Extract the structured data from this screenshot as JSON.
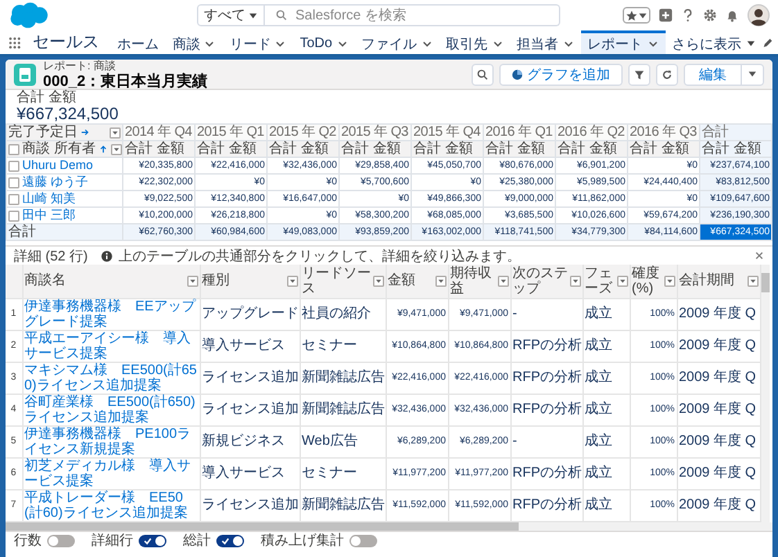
{
  "search": {
    "scope": "すべて",
    "placeholder": "Salesforce を検索"
  },
  "app_name": "セールス",
  "nav_tabs": [
    {
      "label": "ホーム",
      "kind": "plain",
      "selected": false
    },
    {
      "label": "商談",
      "kind": "menu",
      "selected": false
    },
    {
      "label": "リード",
      "kind": "menu",
      "selected": false
    },
    {
      "label": "ToDo",
      "kind": "menu",
      "selected": false
    },
    {
      "label": "ファイル",
      "kind": "menu",
      "selected": false
    },
    {
      "label": "取引先",
      "kind": "menu",
      "selected": false
    },
    {
      "label": "担当者",
      "kind": "menu",
      "selected": false
    },
    {
      "label": "レポート",
      "kind": "menu",
      "selected": true
    },
    {
      "label": "さらに表示",
      "kind": "more",
      "selected": false
    }
  ],
  "report": {
    "type_label": "レポート: 商談",
    "title": "000_2：東日本当月実績",
    "buttons": [
      {
        "kind": "search"
      },
      {
        "kind": "add-chart",
        "label": "グラフを追加"
      },
      {
        "kind": "filter"
      },
      {
        "kind": "refresh"
      },
      {
        "kind": "edit",
        "label": "編集"
      }
    ]
  },
  "summary": {
    "label": "合計 金額",
    "value": "¥667,324,500"
  },
  "matrix": {
    "column_group_label": "完了予定日",
    "row_group_label": "商談 所有者",
    "all_checked": false,
    "columns": [
      {
        "period": "2014 年 Q4",
        "measure": "合計 金額",
        "kind": "period"
      },
      {
        "period": "2015 年 Q1",
        "measure": "合計 金額",
        "kind": "period"
      },
      {
        "period": "2015 年 Q2",
        "measure": "合計 金額",
        "kind": "period"
      },
      {
        "period": "2015 年 Q3",
        "measure": "合計 金額",
        "kind": "period"
      },
      {
        "period": "2015 年 Q4",
        "measure": "合計 金額",
        "kind": "period"
      },
      {
        "period": "2016 年 Q1",
        "measure": "合計 金額",
        "kind": "period"
      },
      {
        "period": "2016 年 Q2",
        "measure": "合計 金額",
        "kind": "period"
      },
      {
        "period": "2016 年 Q3",
        "measure": "合計 金額",
        "kind": "period"
      },
      {
        "period": "合計",
        "measure": "合計 金額",
        "kind": "total"
      }
    ],
    "rows": [
      {
        "owner": "Uhuru Demo",
        "checked": false,
        "values": [
          "¥20,335,800",
          "¥22,416,000",
          "¥32,436,000",
          "¥29,858,400",
          "¥45,050,700",
          "¥80,676,000",
          "¥6,901,200",
          "¥0",
          "¥237,674,100"
        ]
      },
      {
        "owner": "遠藤 ゆう子",
        "checked": false,
        "values": [
          "¥22,302,000",
          "¥0",
          "¥0",
          "¥5,700,600",
          "¥0",
          "¥25,380,000",
          "¥5,989,500",
          "¥24,440,400",
          "¥83,812,500"
        ]
      },
      {
        "owner": "山崎 知美",
        "checked": false,
        "values": [
          "¥9,022,500",
          "¥12,340,800",
          "¥16,647,000",
          "¥0",
          "¥49,866,300",
          "¥9,000,000",
          "¥11,862,000",
          "¥0",
          "¥109,647,600"
        ]
      },
      {
        "owner": "田中 三郎",
        "checked": false,
        "values": [
          "¥10,200,000",
          "¥26,218,800",
          "¥0",
          "¥58,300,200",
          "¥68,085,000",
          "¥3,685,500",
          "¥10,026,600",
          "¥59,674,200",
          "¥236,190,300"
        ]
      }
    ],
    "total_row": {
      "label": "合計",
      "grand_total_selected": true,
      "values": [
        "¥62,760,300",
        "¥60,984,600",
        "¥49,083,000",
        "¥93,859,200",
        "¥163,002,000",
        "¥118,741,500",
        "¥34,779,300",
        "¥84,114,600",
        "¥667,324,500"
      ]
    }
  },
  "details": {
    "title": "詳細 (52 行)",
    "hint": "上のテーブルの共通部分をクリックして、詳細を絞り込みます。",
    "columns": [
      "商談名",
      "種別",
      "リードソース",
      "金額",
      "期待収益",
      "次のステップ",
      "フェーズ",
      "確度(%)",
      "会計期間"
    ],
    "rows": [
      {
        "num": "1",
        "name": "伊達事務機器様　EEアップグレード提案",
        "type": "アップグレード",
        "lead_source": "社員の紹介",
        "amount": "¥9,471,000",
        "expected": "¥9,471,000",
        "next_step": "-",
        "stage": "成立",
        "probability": "100%",
        "fiscal": "2009 年度 Q"
      },
      {
        "num": "2",
        "name": "平成エーアイシー様　導入サービス提案",
        "type": "導入サービス",
        "lead_source": "セミナー",
        "amount": "¥10,864,800",
        "expected": "¥10,864,800",
        "next_step": "RFPの分析",
        "stage": "成立",
        "probability": "100%",
        "fiscal": "2009 年度 Q"
      },
      {
        "num": "3",
        "name": "マキシマム様　EE500(計650)ライセンス追加提案",
        "type": "ライセンス追加",
        "lead_source": "新聞雑誌広告",
        "amount": "¥22,416,000",
        "expected": "¥22,416,000",
        "next_step": "RFPの分析",
        "stage": "成立",
        "probability": "100%",
        "fiscal": "2009 年度 Q"
      },
      {
        "num": "4",
        "name": "谷町産業様　EE500(計650)ライセンス追加提案",
        "type": "ライセンス追加",
        "lead_source": "新聞雑誌広告",
        "amount": "¥32,436,000",
        "expected": "¥32,436,000",
        "next_step": "RFPの分析",
        "stage": "成立",
        "probability": "100%",
        "fiscal": "2009 年度 Q"
      },
      {
        "num": "5",
        "name": "伊達事務機器様　PE100ライセンス新規提案",
        "type": "新規ビジネス",
        "lead_source": "Web広告",
        "amount": "¥6,289,200",
        "expected": "¥6,289,200",
        "next_step": "-",
        "stage": "成立",
        "probability": "100%",
        "fiscal": "2009 年度 Q"
      },
      {
        "num": "6",
        "name": "初芝メディカル様　導入サービス提案",
        "type": "導入サービス",
        "lead_source": "セミナー",
        "amount": "¥11,977,200",
        "expected": "¥11,977,200",
        "next_step": "RFPの分析",
        "stage": "成立",
        "probability": "100%",
        "fiscal": "2009 年度 Q"
      },
      {
        "num": "7",
        "name": "平成トレーダー様　EE50(計60)ライセンス追加提案",
        "type": "ライセンス追加",
        "lead_source": "新聞雑誌広告",
        "amount": "¥11,592,000",
        "expected": "¥11,592,000",
        "next_step": "RFPの分析",
        "stage": "成立",
        "probability": "100%",
        "fiscal": "2009 年度 Q"
      }
    ]
  },
  "footer_toggles": [
    {
      "label": "行数",
      "on": false
    },
    {
      "label": "詳細行",
      "on": true
    },
    {
      "label": "総計",
      "on": true
    },
    {
      "label": "積み上げ集計",
      "on": false
    }
  ]
}
